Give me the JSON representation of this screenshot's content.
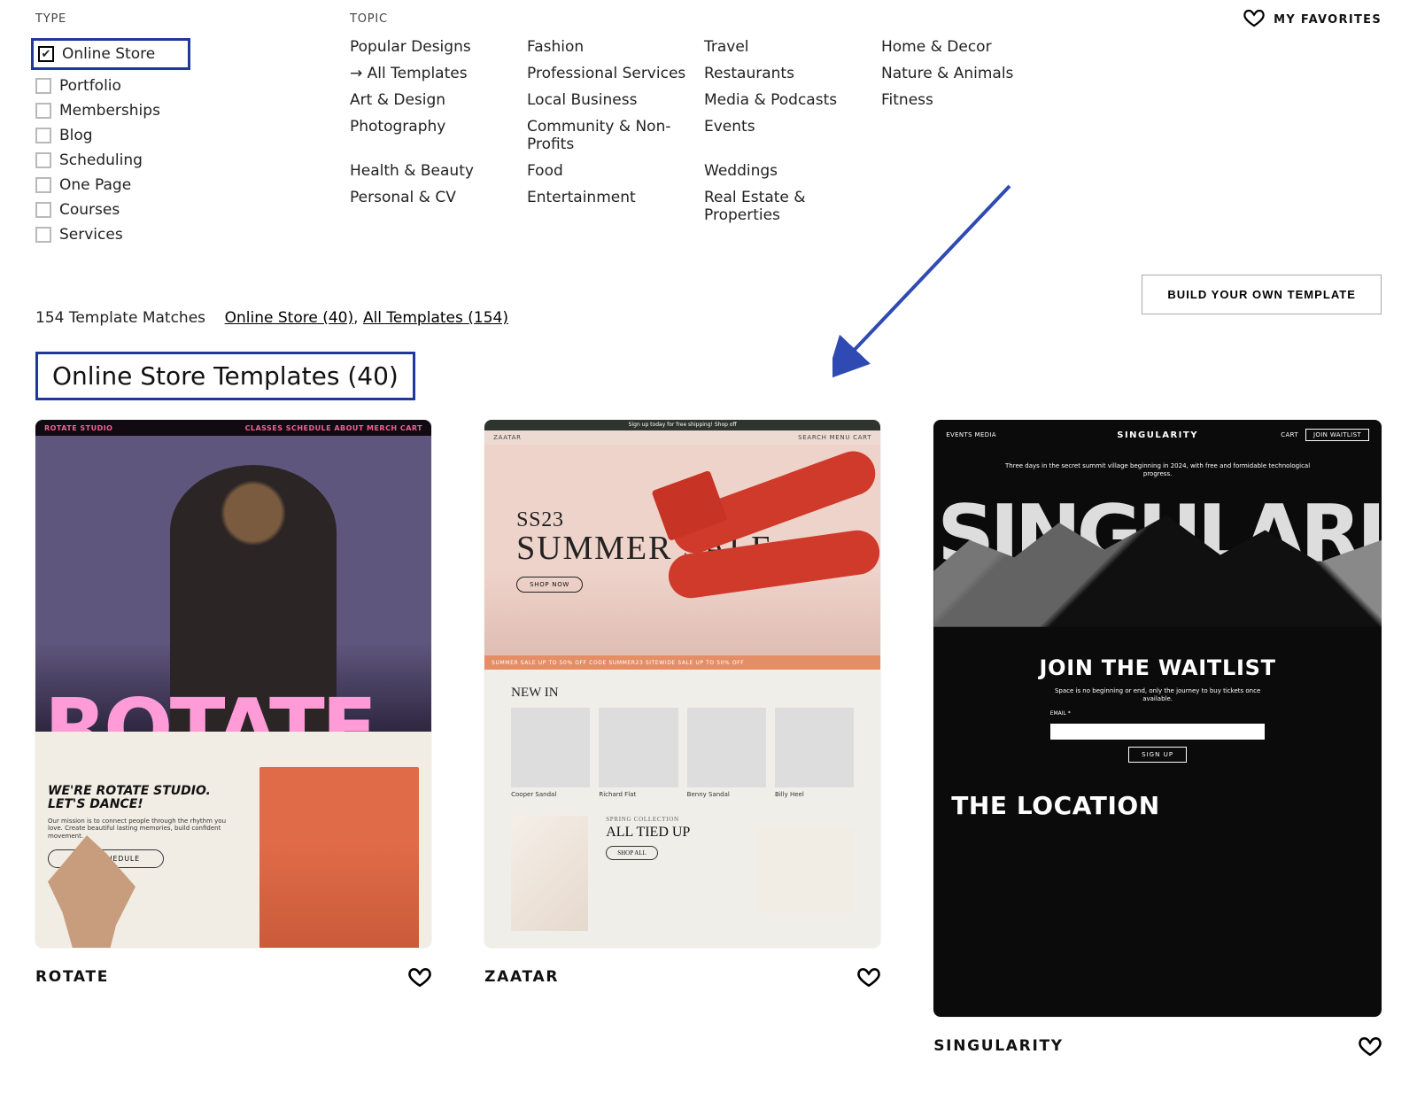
{
  "type_label": "TYPE",
  "topic_label": "TOPIC",
  "favorites_label": "MY FAVORITES",
  "build_button": "BUILD YOUR OWN TEMPLATE",
  "matches_count": "154 Template Matches",
  "matches_link1": "Online Store (40)",
  "matches_sep": ", ",
  "matches_link2": "All Templates (154)",
  "section_heading": "Online Store Templates (40)",
  "type_items": [
    {
      "label": "Online Store",
      "checked": true,
      "highlight": true
    },
    {
      "label": "Portfolio",
      "checked": false
    },
    {
      "label": "Memberships",
      "checked": false
    },
    {
      "label": "Blog",
      "checked": false
    },
    {
      "label": "Scheduling",
      "checked": false
    },
    {
      "label": "One Page",
      "checked": false
    },
    {
      "label": "Courses",
      "checked": false
    },
    {
      "label": "Services",
      "checked": false
    }
  ],
  "topic_columns": [
    [
      "Popular Designs",
      "All Templates",
      "Art & Design",
      "Photography",
      "Health & Beauty",
      "Personal & CV"
    ],
    [
      "Fashion",
      "Professional Services",
      "Local Business",
      "Community & Non-Profits",
      "Food",
      "Entertainment"
    ],
    [
      "Travel",
      "Restaurants",
      "Media & Podcasts",
      "Events",
      "Weddings",
      "Real Estate & Properties"
    ],
    [
      "Home & Decor",
      "Nature & Animals",
      "Fitness"
    ]
  ],
  "topic_active": "All Templates",
  "templates": [
    {
      "title": "ROTATE"
    },
    {
      "title": "ZAATAR"
    },
    {
      "title": "SINGULARITY"
    }
  ],
  "rotate": {
    "brand": "ROTATE STUDIO",
    "nav": "CLASSES   SCHEDULE   ABOUT   MERCH   CART",
    "logo": "ROTATE",
    "headline": "WE'RE ROTATE STUDIO. LET'S DANCE!",
    "sub": "Our mission is to connect people through the rhythm you love. Create beautiful lasting memories, build confident movement.",
    "cta": "VIEW SCHEDULE"
  },
  "zaatar": {
    "topbar": "Sign up today for free shipping! Shop off",
    "navleft": "ZAATAR",
    "navright": "SEARCH   MENU   CART",
    "ss": "SS23",
    "sale": "SUMMER SALE",
    "shop": "SHOP NOW",
    "promo": "SUMMER SALE   UP TO 50% OFF   CODE SUMMER23   SITEWIDE SALE   UP TO 50% OFF",
    "newin": "NEW IN",
    "prods": [
      "Cooper Sandal",
      "Richard Flat",
      "Benny Sandal",
      "Billy Heel"
    ],
    "tied_cat": "SPRING COLLECTION",
    "tied_title": "ALL TIED UP",
    "tied_btn": "SHOP ALL"
  },
  "singularity": {
    "navleft": "EVENTS   MEDIA",
    "brand": "SINGULARITY",
    "navright": "CART",
    "join": "JOIN WAITLIST",
    "blurb": "Three days in the secret summit village beginning in 2024, with free and formidable technological progress.",
    "giant": "SINGULARI",
    "wait": "JOIN THE WAITLIST",
    "waitsub": "Space is no beginning or end, only the journey to buy tickets once available.",
    "emaillabel": "EMAIL *",
    "signup": "SIGN UP",
    "location": "THE LOCATION"
  }
}
